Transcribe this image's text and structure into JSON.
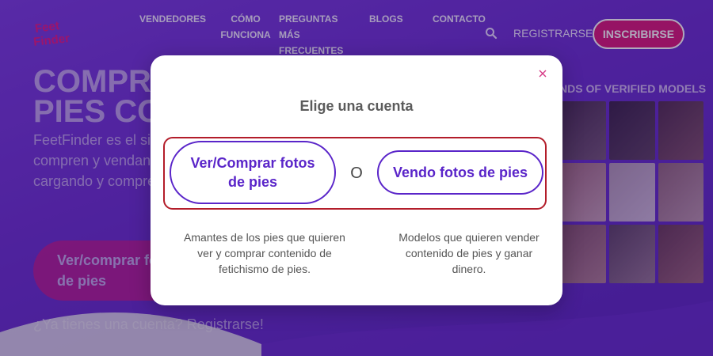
{
  "nav": {
    "logo_text": "Feet Finder",
    "items": [
      "VENDEDORES",
      "CÓMO FUNCIONA",
      "PREGUNTAS MÁS FRECUENTES",
      "BLOGS",
      "CONTACTO"
    ],
    "registrarse": "REGISTRARSE",
    "inscribirse": "INSCRIBIRSE"
  },
  "hero": {
    "title_line1": "COMPRAR",
    "title_line2": "PIES CON",
    "text": "FeetFinder es el sitio protegido para que compren y vendan personalizados. Más cargando y compre",
    "cta": "Ver/comprar fotos de pies",
    "login_hint": "¿Ya tienes una cuenta? Registrarse!"
  },
  "gallery": {
    "title": "NDS OF VERIFIED MODELS"
  },
  "modal": {
    "title": "Elige una cuenta",
    "buy_button": "Ver/Comprar fotos de pies",
    "or": "O",
    "sell_button": "Vendo fotos de pies",
    "buy_desc": "Amantes de los pies que quieren ver y comprar contenido de fetichismo de pies.",
    "sell_desc": "Modelos que quieren vender contenido de pies y ganar dinero."
  },
  "colors": {
    "brand_pink": "#d9197a",
    "brand_purple": "#5a25c9",
    "highlight_red": "#b31d2a"
  }
}
